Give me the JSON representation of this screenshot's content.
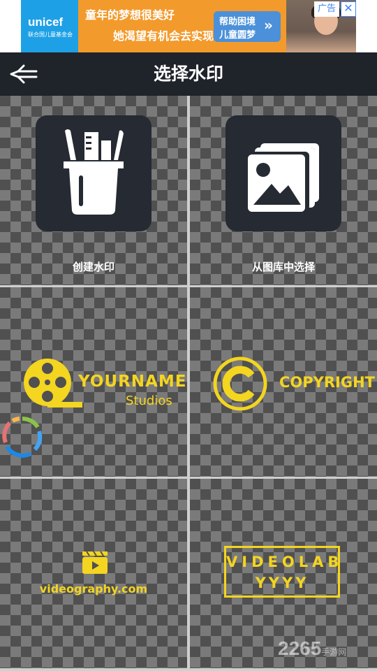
{
  "ad": {
    "brand": "unicef",
    "brand_sub": "联合国儿童基金会",
    "slogan_line1": "童年的梦想很美好",
    "slogan_line2": "她渴望有机会去实现",
    "help_line1": "帮助困境",
    "help_line2": "儿童圆梦",
    "help_arrow": "»",
    "label": "广告",
    "close": "✕"
  },
  "header": {
    "title": "选择水印",
    "back_icon": "arrow-left-icon"
  },
  "grid": {
    "create": {
      "label": "创建水印",
      "icon": "art-supplies-icon"
    },
    "gallery": {
      "label": "从图库中选择",
      "icon": "image-stack-icon"
    },
    "template_yourname": {
      "title": "YOURNAME",
      "subtitle": "Studios",
      "icon": "film-reel-icon"
    },
    "template_copyright": {
      "text": "COPYRIGHT",
      "icon": "copyright-icon"
    },
    "template_videography": {
      "text": "videography.com",
      "icon": "clapperboard-icon"
    },
    "template_videolab": {
      "line1": "VIDEOLAB",
      "line2": "YYYY"
    }
  },
  "colors": {
    "header_bg": "#1f232a",
    "accent_yellow": "#f4d520",
    "tile_bg": "#252a33"
  },
  "watermark": {
    "text": "2265",
    "sub": "手游网"
  }
}
